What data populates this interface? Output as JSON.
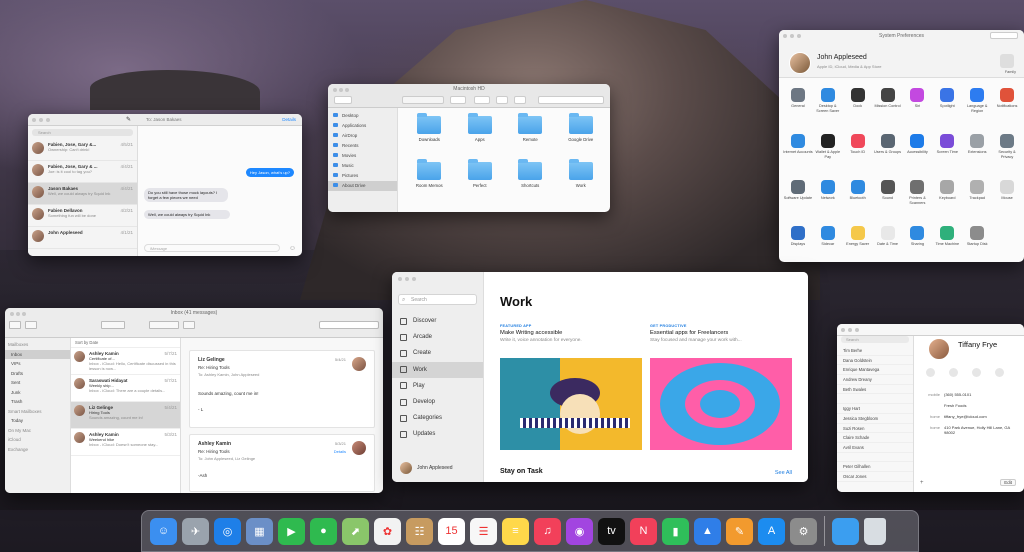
{
  "messages": {
    "search_placeholder": "Search",
    "compose_to": "To: Jason Bakaes",
    "details": "Details",
    "message_placeholder": "iMessage",
    "conversations": [
      {
        "name": "Fabien, Jose, Gary &...",
        "time": "4/5/21",
        "preview": "Ownership: Can't drink!"
      },
      {
        "name": "Fabien, Jose, Gary & ...",
        "time": "4/4/21",
        "preview": "Joe: is it cool to tag you?"
      },
      {
        "name": "Jason Bakaes",
        "time": "4/4/21",
        "preview": "Well, we could always try Squid Ink"
      },
      {
        "name": "Fabien Dellavon",
        "time": "4/2/21",
        "preview": "Something fun will be done"
      },
      {
        "name": "John Appleseed",
        "time": "4/1/21",
        "preview": ""
      }
    ],
    "bubbles": [
      {
        "text": "Hey Jason, what's up?",
        "kind": "out"
      },
      {
        "text": "Do you still have those mock layouts? I forget a few pieces we need",
        "kind": "in"
      },
      {
        "text": "Well, we could always try Squid Ink",
        "kind": "in"
      }
    ]
  },
  "finder": {
    "title": "Macintosh HD",
    "sidebar": [
      "Desktop",
      "Applications",
      "AirDrop",
      "Recents",
      "Movies",
      "Music",
      "Pictures",
      "About Drive"
    ],
    "items": [
      "Downloads",
      "Apps",
      "Remote",
      "Google Drive",
      "Room Memos",
      "Perfect",
      "Shortcuts",
      "Work"
    ]
  },
  "sysprefs": {
    "title": "System Preferences",
    "user_name": "John Appleseed",
    "user_sub": "Apple ID, iCloud, Media & App Store",
    "family_label": "Family",
    "items": [
      {
        "label": "General",
        "color": "#6d7783"
      },
      {
        "label": "Desktop & Screen Saver",
        "color": "#2f8ae0"
      },
      {
        "label": "Dock",
        "color": "#333333"
      },
      {
        "label": "Mission Control",
        "color": "#444444"
      },
      {
        "label": "Siri",
        "color": "#c349e0"
      },
      {
        "label": "Spotlight",
        "color": "#3a74e6"
      },
      {
        "label": "Language & Region",
        "color": "#2d7cf0"
      },
      {
        "label": "Notifications",
        "color": "#e0523a"
      },
      {
        "label": "Internet Accounts",
        "color": "#2f8ae0"
      },
      {
        "label": "Wallet & Apple Pay",
        "color": "#222222"
      },
      {
        "label": "Touch ID",
        "color": "#f0485a"
      },
      {
        "label": "Users & Groups",
        "color": "#5a6672"
      },
      {
        "label": "Accessibility",
        "color": "#1d7be8"
      },
      {
        "label": "Screen Time",
        "color": "#7a4cd8"
      },
      {
        "label": "Extensions",
        "color": "#9aa0a6"
      },
      {
        "label": "Security & Privacy",
        "color": "#6c7a86"
      },
      {
        "label": "Software Update",
        "color": "#5f6b77"
      },
      {
        "label": "Network",
        "color": "#2f8ae0"
      },
      {
        "label": "Bluetooth",
        "color": "#2f8ae0"
      },
      {
        "label": "Sound",
        "color": "#555555"
      },
      {
        "label": "Printers & Scanners",
        "color": "#6f6f6f"
      },
      {
        "label": "Keyboard",
        "color": "#a7a7a7"
      },
      {
        "label": "Trackpad",
        "color": "#b0b0b0"
      },
      {
        "label": "Mouse",
        "color": "#d8d8d8"
      },
      {
        "label": "Displays",
        "color": "#2f6fc8"
      },
      {
        "label": "Sidecar",
        "color": "#2f8ae0"
      },
      {
        "label": "Energy Saver",
        "color": "#f5c84a"
      },
      {
        "label": "Date & Time",
        "color": "#e8e8e8"
      },
      {
        "label": "Sharing",
        "color": "#2f8ae0"
      },
      {
        "label": "Time Machine",
        "color": "#2fb07b"
      },
      {
        "label": "Startup Disk",
        "color": "#8c8c8c"
      },
      {
        "label": "",
        "color": "#ffffff"
      }
    ]
  },
  "mail": {
    "title": "Inbox (41 messages)",
    "sort_label": "Sort by Date",
    "sidebar": [
      "Mailboxes",
      "Inbox",
      "VIPs",
      "Drafts",
      "Sent",
      "Junk",
      "Trash",
      "Smart Mailboxes",
      "Today",
      "On My Mac",
      "iCloud",
      "Exchange"
    ],
    "messages": [
      {
        "from": "Ashley Kamin",
        "time": "5/7/21",
        "subject": "Certificate of...",
        "preview": "Inbox - iCloud: Hello, Certificate discussed in this lesson is now..."
      },
      {
        "from": "Saraswati Hidayat",
        "time": "5/7/21",
        "subject": "Weekly ship...",
        "preview": "Inbox - iCloud: There are a couple details..."
      },
      {
        "from": "Liz Gelinge",
        "time": "5/4/21",
        "subject": "Hiring Tools",
        "preview": "Sounds amazing, count me in!"
      },
      {
        "from": "Ashley Kamin",
        "time": "5/3/21",
        "subject": "Weekend hike",
        "preview": "Inbox - iCloud: Doesn't someone stay..."
      }
    ],
    "reading": [
      {
        "from": "Liz Gelinge",
        "time": "5/4/21",
        "subject": "Re: Hiring Tools",
        "to": "To: Ashley Kamin, John Appleseed",
        "body": "Sounds amazing, count me in!",
        "sign": "- L"
      },
      {
        "from": "Ashley Kamin",
        "time": "5/3/21",
        "subject": "Re: Hiring Tools",
        "to": "To: John Appleseed, Liz Gelinge",
        "body": "-Ash",
        "details": "Details"
      }
    ]
  },
  "appstore": {
    "search_placeholder": "Search",
    "nav": [
      "Discover",
      "Arcade",
      "Create",
      "Work",
      "Play",
      "Develop",
      "Categories",
      "Updates"
    ],
    "user": "John Appleseed",
    "page_title": "Work",
    "cards": [
      {
        "tag": "FEATURED APP",
        "title": "Make Writing accessible",
        "subtitle": "Write it, voice annotation for everyone."
      },
      {
        "tag": "GET PRODUCTIVE",
        "title": "Essential apps for Freelancers",
        "subtitle": "Stay focused and manage your work with..."
      }
    ],
    "section": "Stay on Task",
    "see_all": "See All"
  },
  "contacts": {
    "search_placeholder": "Search",
    "names": [
      "Tim Berhe",
      "Dana Goldstein",
      "Enrique Mantavega",
      "Andrew Dreany",
      "Beth Swales",
      "",
      "Iggy Hart",
      "Jessica Stegbloom",
      "Suzi Rosen",
      "Claire Schade",
      "Avril Evans",
      "",
      "Peter Gilhallen",
      "Oscar Jones"
    ],
    "selected_name": "Tiffany Frye",
    "actions": [
      "message",
      "call",
      "video",
      "mail"
    ],
    "fields": [
      {
        "label": "mobile",
        "value": "(360) 555-0101"
      },
      {
        "label": "",
        "value": "Fresh Foods"
      },
      {
        "label": "home",
        "value": "tiffany_frye@icloud.com"
      },
      {
        "label": "home",
        "value": "410 Park Avenue, Holly Hill Lane, GA 98002"
      }
    ],
    "edit_label": "Edit"
  },
  "dock": {
    "apps": [
      {
        "name": "Finder",
        "color": "#3b8ff0",
        "glyph": "☺"
      },
      {
        "name": "Launchpad",
        "color": "#9aa3ad",
        "glyph": "✈"
      },
      {
        "name": "Safari",
        "color": "#1e7fe8",
        "glyph": "◎"
      },
      {
        "name": "Preview",
        "color": "#6b8fc7",
        "glyph": "▦"
      },
      {
        "name": "FaceTime",
        "color": "#2fba4f",
        "glyph": "▶"
      },
      {
        "name": "Messages",
        "color": "#2fba4f",
        "glyph": "●"
      },
      {
        "name": "Maps",
        "color": "#8ac66a",
        "glyph": "⬈"
      },
      {
        "name": "Photos",
        "color": "#f2f2f2",
        "glyph": "✿"
      },
      {
        "name": "Contacts",
        "color": "#c79b60",
        "glyph": "☷"
      },
      {
        "name": "Calendar",
        "color": "#ffffff",
        "glyph": "15"
      },
      {
        "name": "Reminders",
        "color": "#f7f7f7",
        "glyph": "☰"
      },
      {
        "name": "Notes",
        "color": "#ffd84a",
        "glyph": "≡"
      },
      {
        "name": "Music",
        "color": "#f2405a",
        "glyph": "♫"
      },
      {
        "name": "Podcasts",
        "color": "#a245e0",
        "glyph": "◉"
      },
      {
        "name": "TV",
        "color": "#111111",
        "glyph": "tv"
      },
      {
        "name": "News",
        "color": "#f2405a",
        "glyph": "N"
      },
      {
        "name": "Numbers",
        "color": "#2fbf5a",
        "glyph": "▮"
      },
      {
        "name": "Keynote",
        "color": "#2f7ee8",
        "glyph": "▲"
      },
      {
        "name": "Pages",
        "color": "#f29a2e",
        "glyph": "✎"
      },
      {
        "name": "App Store",
        "color": "#1c8cf0",
        "glyph": "A"
      },
      {
        "name": "System Preferences",
        "color": "#8c8c8c",
        "glyph": "⚙"
      }
    ],
    "folder_color": "#3b9ef0",
    "trash_color": "#d8dde2"
  }
}
